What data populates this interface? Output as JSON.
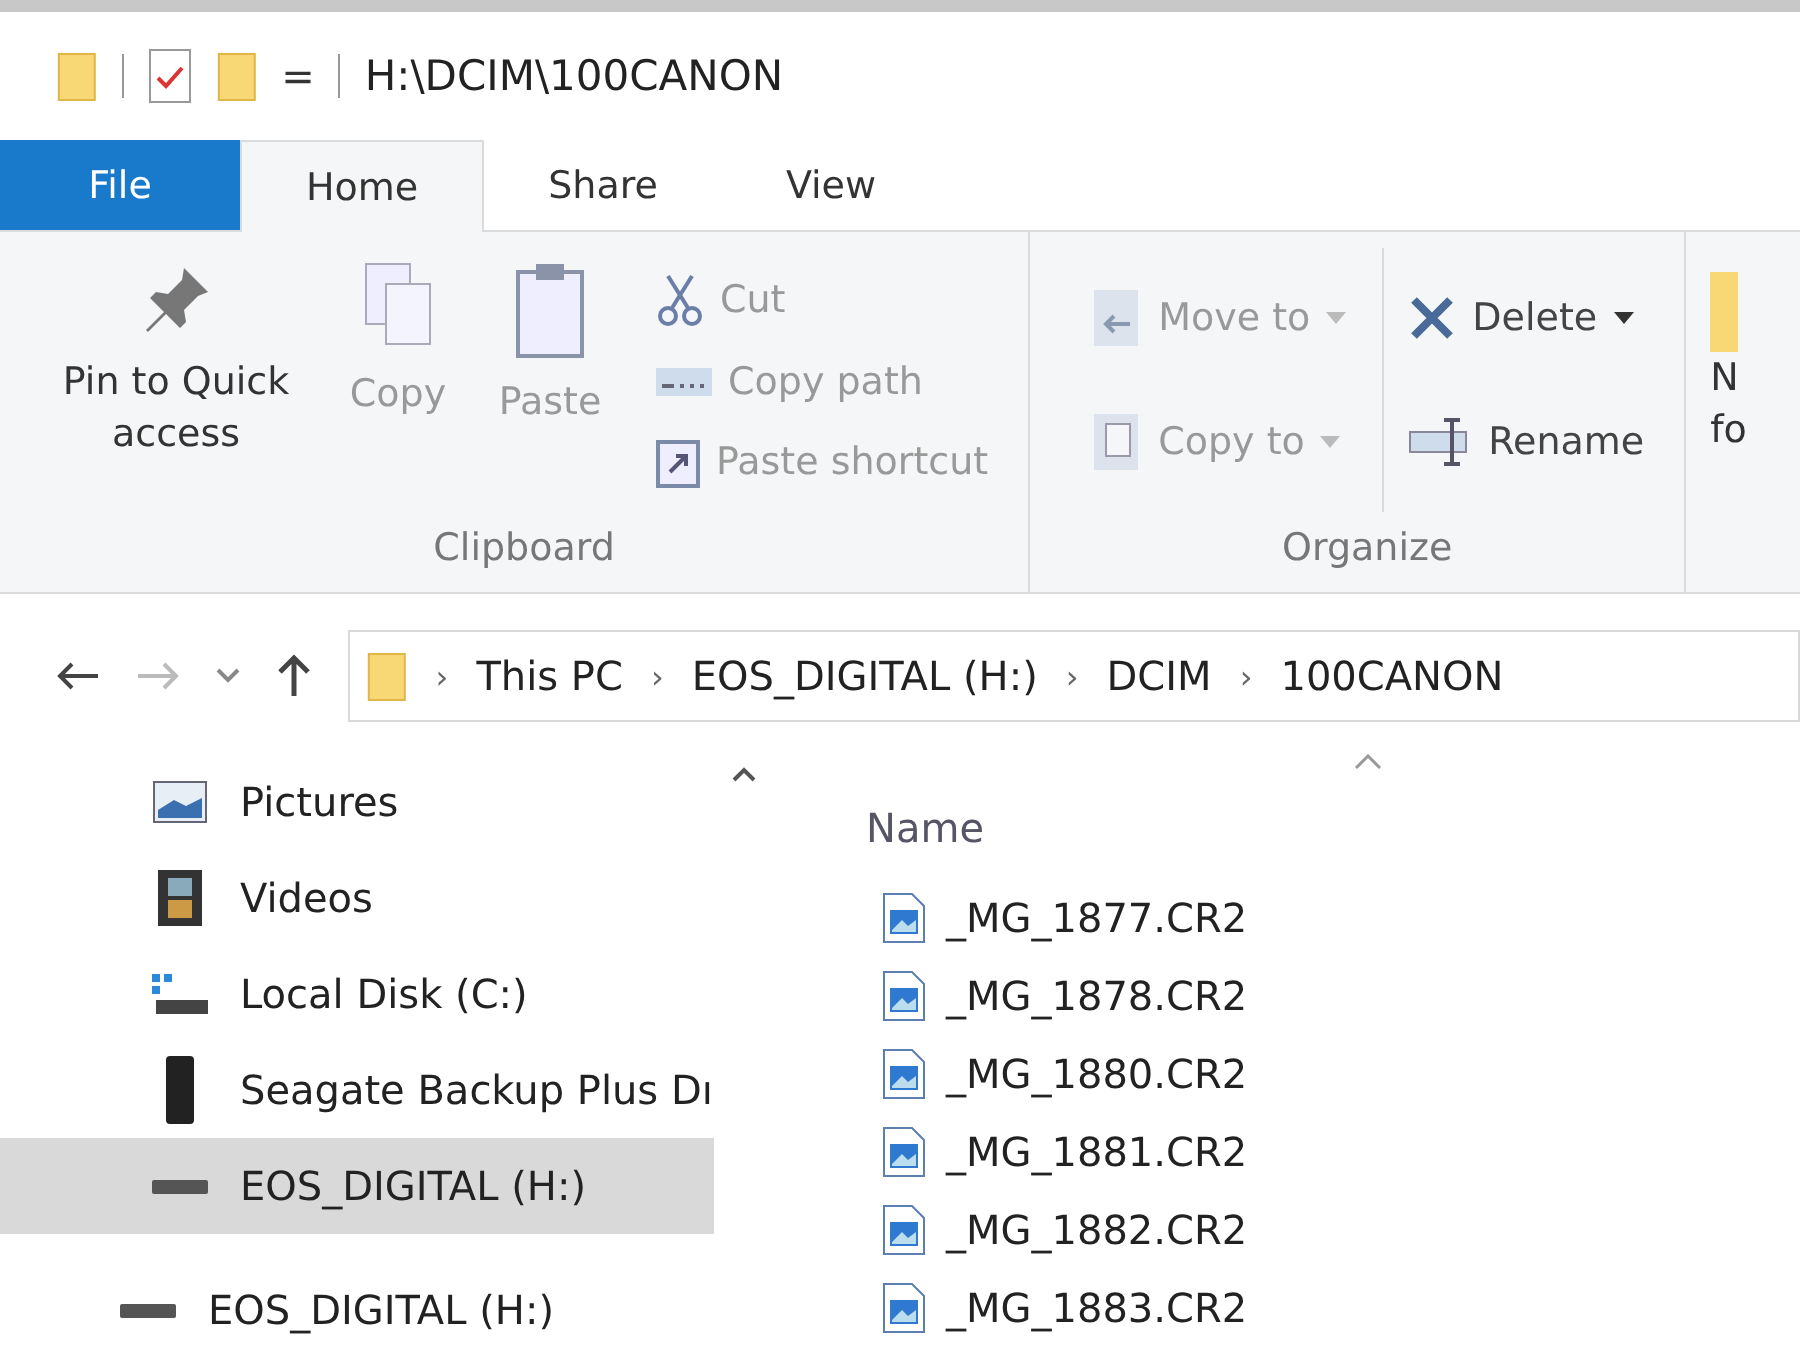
{
  "window": {
    "title": "H:\\DCIM\\100CANON",
    "quick_access_menu": "="
  },
  "tabs": [
    {
      "label": "File",
      "kind": "file",
      "selected": false
    },
    {
      "label": "Home",
      "kind": "tab",
      "selected": true
    },
    {
      "label": "Share",
      "kind": "tab",
      "selected": false
    },
    {
      "label": "View",
      "kind": "tab",
      "selected": false
    }
  ],
  "ribbon": {
    "groups": [
      {
        "label": "Clipboard",
        "large": [
          {
            "label": "Pin to Quick access",
            "disabled": false
          },
          {
            "label": "Copy",
            "disabled": true
          },
          {
            "label": "Paste",
            "disabled": true
          }
        ],
        "small": [
          [
            {
              "label": "Cut",
              "disabled": true
            },
            {
              "label": "Copy path",
              "disabled": true
            },
            {
              "label": "Paste shortcut",
              "disabled": true
            }
          ]
        ]
      },
      {
        "label": "Organize",
        "small": [
          [
            {
              "label": "Move to",
              "disabled": true,
              "dropdown": true
            },
            {
              "label": "Copy to",
              "disabled": true,
              "dropdown": true
            }
          ],
          [
            {
              "label": "Delete",
              "disabled": false,
              "dropdown": true
            },
            {
              "label": "Rename",
              "disabled": false,
              "dropdown": false
            }
          ]
        ]
      }
    ],
    "partial_group_label": [
      "N",
      "fo"
    ]
  },
  "address": {
    "separator": "›",
    "crumbs": [
      "This PC",
      "EOS_DIGITAL (H:)",
      "DCIM",
      "100CANON"
    ]
  },
  "nav_pane": {
    "items": [
      {
        "label": "Pictures",
        "kind": "pictures",
        "selected": false
      },
      {
        "label": "Videos",
        "kind": "videos",
        "selected": false
      },
      {
        "label": "Local Disk (C:)",
        "kind": "disk",
        "selected": false
      },
      {
        "label": "Seagate Backup Plus Dı",
        "kind": "external",
        "selected": false
      },
      {
        "label": "EOS_DIGITAL (H:)",
        "kind": "drive",
        "selected": true
      }
    ],
    "root_items": [
      {
        "label": "EOS_DIGITAL (H:)",
        "kind": "drive",
        "selected": false
      }
    ]
  },
  "file_list": {
    "columns": [
      "Name"
    ],
    "rows": [
      "_MG_1877.CR2",
      "_MG_1878.CR2",
      "_MG_1880.CR2",
      "_MG_1881.CR2",
      "_MG_1882.CR2",
      "_MG_1883.CR2"
    ]
  }
}
